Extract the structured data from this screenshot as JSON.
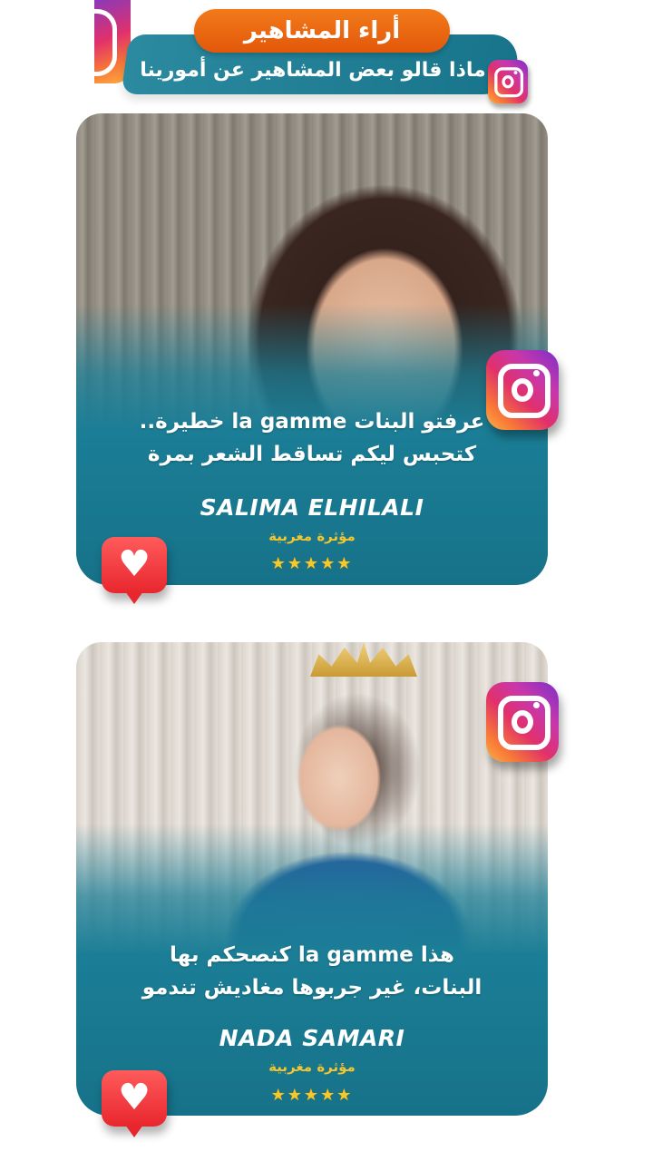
{
  "header": {
    "title": "أراء المشاهير",
    "subtitle": "ماذا قالو بعض المشاهير عن أمورينا"
  },
  "testimonials": [
    {
      "quote_line1": "عرفتو البنات la gamme خطيرة..",
      "quote_line2": "كتحبس ليكم تساقط الشعر بمرة",
      "name": "SALIMA ELHILALI",
      "role": "مؤثرة مغربية",
      "rating": "★★★★★"
    },
    {
      "quote_line1": "هذا la gamme كنصحكم بها",
      "quote_line2": "البنات، غير جربوها مغاديش تندمو",
      "name": "NADA SAMARI",
      "role": "مؤثرة مغربية",
      "rating": "★★★★★"
    }
  ],
  "icons": {
    "social": "instagram-icon",
    "like": "heart-icon"
  },
  "colors": {
    "teal": "#1b7e96",
    "orange": "#e86610",
    "gold": "#f3c531",
    "heart_red": "#e8262e"
  }
}
